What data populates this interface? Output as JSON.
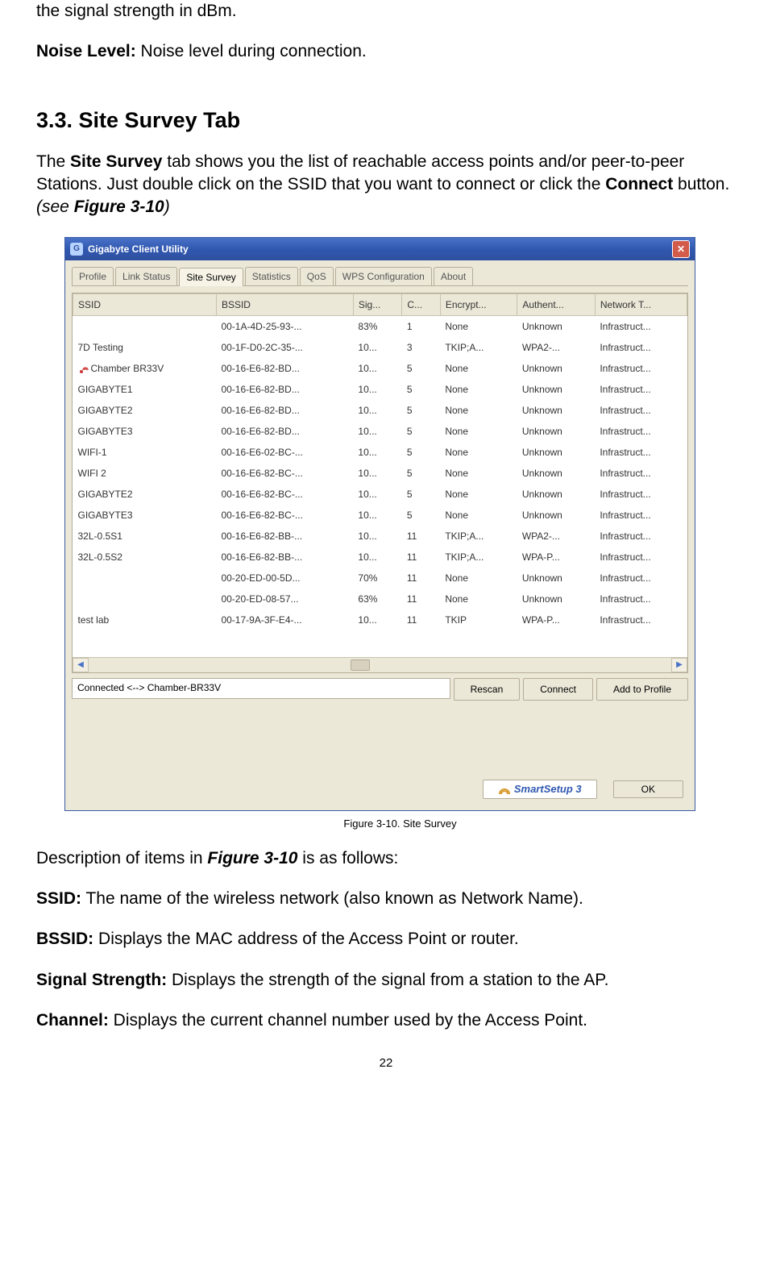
{
  "frag_top": "the signal strength in dBm.",
  "noise_line": {
    "label": "Noise Level:",
    "text": " Noise level during connection."
  },
  "section_heading": "3.3.  Site Survey Tab",
  "intro_parts": {
    "p1a": "The ",
    "p1b": "Site Survey",
    "p1c": " tab shows you the list of reachable access points and/or peer-to-peer Stations. Just double click on the SSID that you want to connect or click the ",
    "p1d": "Connect",
    "p1e": " button. ",
    "p1f": "(see ",
    "p1g": "Figure 3-10",
    "p1h": ")"
  },
  "window": {
    "title": "Gigabyte Client Utility",
    "tabs": [
      "Profile",
      "Link Status",
      "Site Survey",
      "Statistics",
      "QoS",
      "WPS Configuration",
      "About"
    ],
    "active_tab": 2,
    "headers": [
      "SSID",
      "BSSID",
      "Sig...",
      "C...",
      "Encrypt...",
      "Authent...",
      "Network T..."
    ],
    "rows": [
      {
        "ssid": "",
        "bssid": "00-1A-4D-25-93-...",
        "sig": "83%",
        "ch": "1",
        "enc": "None",
        "auth": "Unknown",
        "nt": "Infrastruct...",
        "conn": false
      },
      {
        "ssid": "7D Testing",
        "bssid": "00-1F-D0-2C-35-...",
        "sig": "10...",
        "ch": "3",
        "enc": "TKIP;A...",
        "auth": "WPA2-...",
        "nt": "Infrastruct...",
        "conn": false
      },
      {
        "ssid": "Chamber BR33V",
        "bssid": "00-16-E6-82-BD...",
        "sig": "10...",
        "ch": "5",
        "enc": "None",
        "auth": "Unknown",
        "nt": "Infrastruct...",
        "conn": true
      },
      {
        "ssid": "GIGABYTE1",
        "bssid": "00-16-E6-82-BD...",
        "sig": "10...",
        "ch": "5",
        "enc": "None",
        "auth": "Unknown",
        "nt": "Infrastruct...",
        "conn": false
      },
      {
        "ssid": "GIGABYTE2",
        "bssid": "00-16-E6-82-BD...",
        "sig": "10...",
        "ch": "5",
        "enc": "None",
        "auth": "Unknown",
        "nt": "Infrastruct...",
        "conn": false
      },
      {
        "ssid": "GIGABYTE3",
        "bssid": "00-16-E6-82-BD...",
        "sig": "10...",
        "ch": "5",
        "enc": "None",
        "auth": "Unknown",
        "nt": "Infrastruct...",
        "conn": false
      },
      {
        "ssid": "WIFI-1",
        "bssid": "00-16-E6-02-BC-...",
        "sig": "10...",
        "ch": "5",
        "enc": "None",
        "auth": "Unknown",
        "nt": "Infrastruct...",
        "conn": false
      },
      {
        "ssid": "WIFI 2",
        "bssid": "00-16-E6-82-BC-...",
        "sig": "10...",
        "ch": "5",
        "enc": "None",
        "auth": "Unknown",
        "nt": "Infrastruct...",
        "conn": false
      },
      {
        "ssid": "GIGABYTE2",
        "bssid": "00-16-E6-82-BC-...",
        "sig": "10...",
        "ch": "5",
        "enc": "None",
        "auth": "Unknown",
        "nt": "Infrastruct...",
        "conn": false
      },
      {
        "ssid": "GIGABYTE3",
        "bssid": "00-16-E6-82-BC-...",
        "sig": "10...",
        "ch": "5",
        "enc": "None",
        "auth": "Unknown",
        "nt": "Infrastruct...",
        "conn": false
      },
      {
        "ssid": "32L-0.5S1",
        "bssid": "00-16-E6-82-BB-...",
        "sig": "10...",
        "ch": "11",
        "enc": "TKIP;A...",
        "auth": "WPA2-...",
        "nt": "Infrastruct...",
        "conn": false
      },
      {
        "ssid": "32L-0.5S2",
        "bssid": "00-16-E6-82-BB-...",
        "sig": "10...",
        "ch": "11",
        "enc": "TKIP;A...",
        "auth": "WPA-P...",
        "nt": "Infrastruct...",
        "conn": false
      },
      {
        "ssid": "",
        "bssid": "00-20-ED-00-5D...",
        "sig": "70%",
        "ch": "11",
        "enc": "None",
        "auth": "Unknown",
        "nt": "Infrastruct...",
        "conn": false
      },
      {
        "ssid": "",
        "bssid": "00-20-ED-08-57...",
        "sig": "63%",
        "ch": "11",
        "enc": "None",
        "auth": "Unknown",
        "nt": "Infrastruct...",
        "conn": false
      },
      {
        "ssid": "test lab",
        "bssid": "00-17-9A-3F-E4-...",
        "sig": "10...",
        "ch": "11",
        "enc": "TKIP",
        "auth": "WPA-P...",
        "nt": "Infrastruct...",
        "conn": false
      }
    ],
    "status_text": "Connected <--> Chamber-BR33V",
    "buttons": {
      "rescan": "Rescan",
      "connect": "Connect",
      "add": "Add to Profile"
    },
    "smart": "SmartSetup 3",
    "ok": "OK"
  },
  "caption": "Figure 3-10.    Site Survey",
  "desc_intro": {
    "a": "Description of items in ",
    "b": "Figure 3-10",
    "c": " is as follows:"
  },
  "defs": {
    "ssid": {
      "label": "SSID:",
      "text": " The name of the wireless network (also known as Network Name)."
    },
    "bssid": {
      "label": "BSSID:",
      "text": " Displays the MAC address of the Access Point or router."
    },
    "sig": {
      "label": "Signal Strength:",
      "text": " Displays the strength of the signal from a station to the AP."
    },
    "channel": {
      "label": "Channel:",
      "text": " Displays the current channel number used by the Access Point."
    }
  },
  "page_number": "22"
}
